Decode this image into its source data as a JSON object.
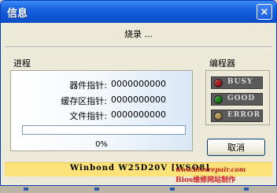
{
  "window": {
    "title": "信息",
    "close_symbol": "×"
  },
  "status": {
    "text": "烧录 ..."
  },
  "progress_section": {
    "label": "进程",
    "counters": [
      {
        "label": "器件指针:",
        "value": "0000000000"
      },
      {
        "label": "缓存区指针:",
        "value": "0000000000"
      },
      {
        "label": "文件指针:",
        "value": "0000000000"
      }
    ],
    "progress_fraction": 0,
    "percent_text": "0%"
  },
  "programmer_section": {
    "label": "编程器",
    "leds": [
      {
        "label": "BUSY",
        "color": "#b01e1e"
      },
      {
        "label": "GOOD",
        "color": "#1c8a1c"
      },
      {
        "label": "ERROR",
        "color": "#b89a5a"
      }
    ]
  },
  "cancel_label": "取消",
  "chip_text": "Winbond   W25D20V [WSO8]",
  "watermark": {
    "brand_prefix": "B",
    "brand_rest": "ios维修网站制作",
    "domain": "www.biosrepair.com"
  }
}
